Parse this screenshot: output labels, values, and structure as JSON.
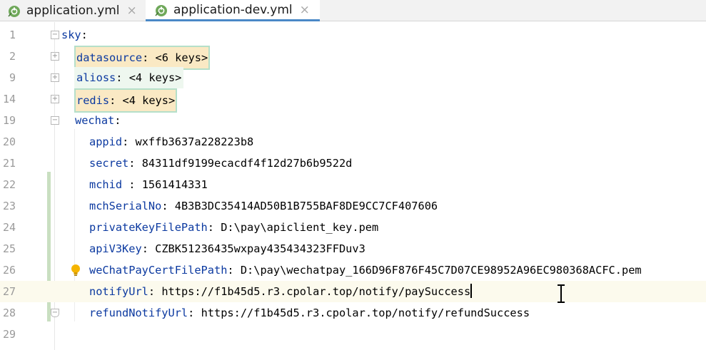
{
  "tabs": [
    {
      "name": "application.yml",
      "close": "×"
    },
    {
      "name": "application-dev.yml",
      "close": "×"
    }
  ],
  "colors": {
    "key": "#0b39a0",
    "folded_bg": "#fae9c4",
    "folded_border": "#b5dfc9",
    "current_line": "#fcfaed",
    "change_bar": "#c9dfc1",
    "active_tab_underline": "#4a88c7"
  },
  "lines": [
    {
      "num": "1",
      "key": "sky",
      "sep": ":",
      "value": ""
    },
    {
      "num": "2",
      "key": "datasource",
      "sep": ": ",
      "value": "<6 keys>"
    },
    {
      "num": "9",
      "key": "alioss",
      "sep": ": ",
      "value": "<4 keys>"
    },
    {
      "num": "14",
      "key": "redis",
      "sep": ": ",
      "value": "<4 keys>"
    },
    {
      "num": "19",
      "key": "wechat",
      "sep": ":",
      "value": ""
    },
    {
      "num": "20",
      "key": "appid",
      "sep": ": ",
      "value": "wxffb3637a228223b8"
    },
    {
      "num": "21",
      "key": "secret",
      "sep": ": ",
      "value": "84311df9199ecacdf4f12d27b6b9522d"
    },
    {
      "num": "22",
      "key": "mchid",
      "sep": " : ",
      "value": "1561414331"
    },
    {
      "num": "23",
      "key": "mchSerialNo",
      "sep": ": ",
      "value": "4B3B3DC35414AD50B1B755BAF8DE9CC7CF407606"
    },
    {
      "num": "24",
      "key": "privateKeyFilePath",
      "sep": ": ",
      "value": "D:\\pay\\apiclient_key.pem"
    },
    {
      "num": "25",
      "key": "apiV3Key",
      "sep": ": ",
      "value": "CZBK51236435wxpay435434323FFDuv3"
    },
    {
      "num": "26",
      "key": "weChatPayCertFilePath",
      "sep": ": ",
      "value": "D:\\pay\\wechatpay_166D96F876F45C7D07CE98952A96EC980368ACFC.pem"
    },
    {
      "num": "27",
      "key": "notifyUrl",
      "sep": ": ",
      "value": "https://f1b45d5.r3.cpolar.top/notify/paySuccess"
    },
    {
      "num": "28",
      "key": "refundNotifyUrl",
      "sep": ": ",
      "value": "https://f1b45d5.r3.cpolar.top/notify/refundSuccess"
    },
    {
      "num": "29",
      "key": "",
      "sep": "",
      "value": ""
    }
  ]
}
